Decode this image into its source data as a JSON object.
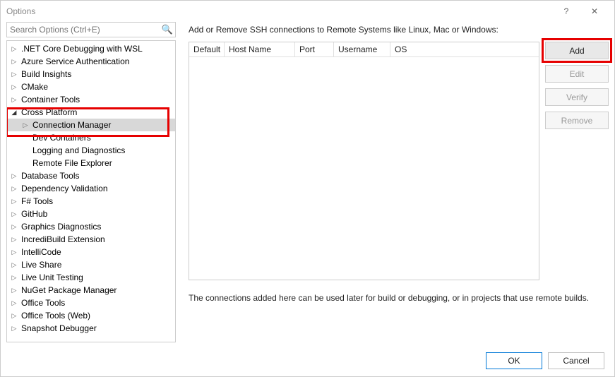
{
  "window": {
    "title": "Options",
    "help": "?",
    "close": "✕"
  },
  "search": {
    "placeholder": "Search Options (Ctrl+E)"
  },
  "tree": {
    "items": [
      {
        "label": ".NET Core Debugging with WSL",
        "depth": 1,
        "arrow": "right"
      },
      {
        "label": "Azure Service Authentication",
        "depth": 1,
        "arrow": "right"
      },
      {
        "label": "Build Insights",
        "depth": 1,
        "arrow": "right"
      },
      {
        "label": "CMake",
        "depth": 1,
        "arrow": "right"
      },
      {
        "label": "Container Tools",
        "depth": 1,
        "arrow": "right"
      },
      {
        "label": "Cross Platform",
        "depth": 1,
        "arrow": "down"
      },
      {
        "label": "Connection Manager",
        "depth": 2,
        "arrow": "right",
        "selected": true
      },
      {
        "label": "Dev Containers",
        "depth": 2,
        "arrow": "none"
      },
      {
        "label": "Logging and Diagnostics",
        "depth": 2,
        "arrow": "none"
      },
      {
        "label": "Remote File Explorer",
        "depth": 2,
        "arrow": "none"
      },
      {
        "label": "Database Tools",
        "depth": 1,
        "arrow": "right"
      },
      {
        "label": "Dependency Validation",
        "depth": 1,
        "arrow": "right"
      },
      {
        "label": "F# Tools",
        "depth": 1,
        "arrow": "right"
      },
      {
        "label": "GitHub",
        "depth": 1,
        "arrow": "right"
      },
      {
        "label": "Graphics Diagnostics",
        "depth": 1,
        "arrow": "right"
      },
      {
        "label": "IncrediBuild Extension",
        "depth": 1,
        "arrow": "right"
      },
      {
        "label": "IntelliCode",
        "depth": 1,
        "arrow": "right"
      },
      {
        "label": "Live Share",
        "depth": 1,
        "arrow": "right"
      },
      {
        "label": "Live Unit Testing",
        "depth": 1,
        "arrow": "right"
      },
      {
        "label": "NuGet Package Manager",
        "depth": 1,
        "arrow": "right"
      },
      {
        "label": "Office Tools",
        "depth": 1,
        "arrow": "right"
      },
      {
        "label": "Office Tools (Web)",
        "depth": 1,
        "arrow": "right"
      },
      {
        "label": "Snapshot Debugger",
        "depth": 1,
        "arrow": "right"
      }
    ]
  },
  "main": {
    "desc": "Add or Remove SSH connections to Remote Systems like Linux, Mac or Windows:",
    "columns": {
      "c0": "Default",
      "c1": "Host Name",
      "c2": "Port",
      "c3": "Username",
      "c4": "OS"
    },
    "buttons": {
      "add": "Add",
      "edit": "Edit",
      "verify": "Verify",
      "remove": "Remove"
    },
    "footnote": "The connections added here can be used later for build or debugging, or in projects that use remote builds."
  },
  "dialog": {
    "ok": "OK",
    "cancel": "Cancel"
  }
}
